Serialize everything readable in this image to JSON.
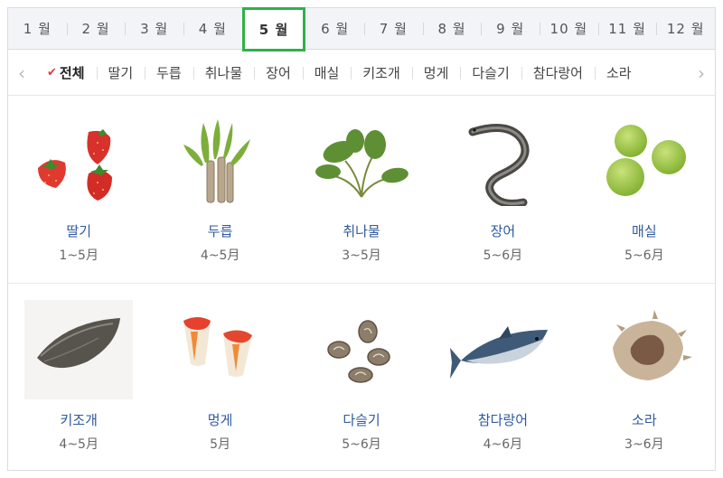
{
  "months": [
    {
      "label": "1 월"
    },
    {
      "label": "2 월"
    },
    {
      "label": "3 월"
    },
    {
      "label": "4 월"
    },
    {
      "label": "5 월"
    },
    {
      "label": "6 월"
    },
    {
      "label": "7 월"
    },
    {
      "label": "8 월"
    },
    {
      "label": "9 월"
    },
    {
      "label": "10 월"
    },
    {
      "label": "11 월"
    },
    {
      "label": "12 월"
    }
  ],
  "selected_month": "5 월",
  "categories": [
    {
      "label": "전체"
    },
    {
      "label": "딸기"
    },
    {
      "label": "두릅"
    },
    {
      "label": "취나물"
    },
    {
      "label": "장어"
    },
    {
      "label": "매실"
    },
    {
      "label": "키조개"
    },
    {
      "label": "멍게"
    },
    {
      "label": "다슬기"
    },
    {
      "label": "참다랑어"
    },
    {
      "label": "소라"
    }
  ],
  "selected_category": "전체",
  "items": [
    [
      {
        "name": "딸기",
        "period": "1~5月",
        "icon": "strawberry-icon"
      },
      {
        "name": "두릅",
        "period": "4~5月",
        "icon": "fatsia-shoot-icon"
      },
      {
        "name": "취나물",
        "period": "3~5月",
        "icon": "aster-greens-icon"
      },
      {
        "name": "장어",
        "period": "5~6月",
        "icon": "eel-icon"
      },
      {
        "name": "매실",
        "period": "5~6月",
        "icon": "green-plum-icon"
      }
    ],
    [
      {
        "name": "키조개",
        "period": "4~5月",
        "icon": "pen-shell-icon"
      },
      {
        "name": "멍게",
        "period": "5月",
        "icon": "sea-squirt-icon"
      },
      {
        "name": "다슬기",
        "period": "5~6月",
        "icon": "marsh-snail-icon"
      },
      {
        "name": "참다랑어",
        "period": "4~6月",
        "icon": "bluefin-tuna-icon"
      },
      {
        "name": "소라",
        "period": "3~6月",
        "icon": "turban-shell-icon"
      }
    ]
  ],
  "colors": {
    "active_tab_border": "#2fb149",
    "item_name": "#2d5a9e",
    "check_mark": "#e23b3b"
  }
}
